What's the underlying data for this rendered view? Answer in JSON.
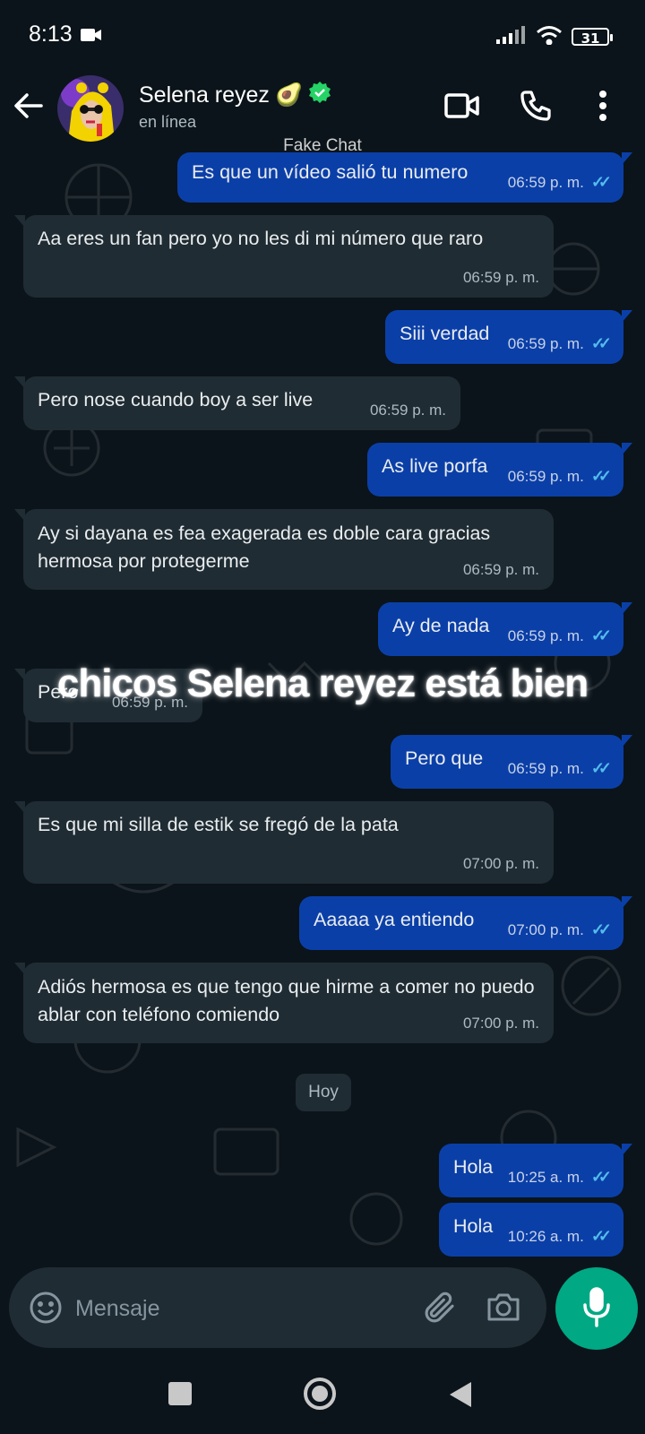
{
  "status_bar": {
    "time": "8:13",
    "battery": "31"
  },
  "header": {
    "contact_name": "Selena reyez",
    "name_emoji": "🥑",
    "status": "en línea"
  },
  "watermark": "Fake Chat",
  "messages": [
    {
      "dir": "out",
      "text": "Es que un vídeo salió tu numero",
      "time": "06:59 p. m."
    },
    {
      "dir": "in",
      "text": "Aa eres un fan pero yo no les di mi número que raro",
      "time": "06:59 p. m."
    },
    {
      "dir": "out",
      "text": "Siii verdad",
      "time": "06:59 p. m."
    },
    {
      "dir": "in",
      "text": "Pero nose cuando boy a ser live",
      "time": "06:59 p. m."
    },
    {
      "dir": "out",
      "text": "As live porfa",
      "time": "06:59 p. m."
    },
    {
      "dir": "in",
      "text": "Ay si dayana es fea exagerada es doble cara gracias hermosa por protegerme",
      "time": "06:59 p. m."
    },
    {
      "dir": "out",
      "text": "Ay de nada",
      "time": "06:59 p. m."
    },
    {
      "dir": "in",
      "text": "Pero",
      "time": "06:59 p. m."
    },
    {
      "dir": "out",
      "text": "Pero que",
      "time": "06:59 p. m."
    },
    {
      "dir": "in",
      "text": "Es que mi silla  de estik se fregó de la pata",
      "time": "07:00 p. m."
    },
    {
      "dir": "out",
      "text": "Aaaaa ya entiendo",
      "time": "07:00 p. m."
    },
    {
      "dir": "in",
      "text": "Adiós hermosa es que tengo que hirme a comer no puedo ablar con teléfono comiendo",
      "time": "07:00 p. m."
    },
    {
      "dir": "out",
      "text": "Hola",
      "time": "10:25 a. m."
    },
    {
      "dir": "out",
      "text": "Hola",
      "time": "10:26 a. m."
    }
  ],
  "day_separator": "Hoy",
  "overlay_caption": "chicos Selena reyez está bien",
  "composer": {
    "placeholder": "Mensaje"
  },
  "colors": {
    "incoming": "#202c33",
    "outgoing": "#0b3fa8",
    "mic": "#00a884",
    "ticks": "#53bdeb"
  }
}
